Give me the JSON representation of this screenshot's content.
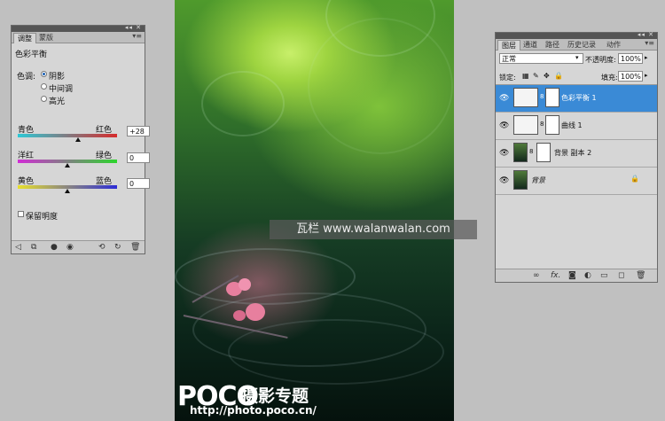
{
  "adjustments": {
    "tabs": [
      "调整",
      "蒙版"
    ],
    "title": "色彩平衡",
    "tone_label": "色调:",
    "tones": [
      "阴影",
      "中间调",
      "高光"
    ],
    "selected_tone": "阴影",
    "sliders": [
      {
        "left": "青色",
        "right": "红色",
        "value": "+28",
        "level": 0.61
      },
      {
        "left": "洋红",
        "right": "绿色",
        "value": "0",
        "level": 0.5
      },
      {
        "left": "黄色",
        "right": "蓝色",
        "value": "0",
        "level": 0.5
      }
    ],
    "preserve_luminosity": "保留明度",
    "footer_icons": [
      "back-icon",
      "clip-icon",
      "eye-icon",
      "view-previous-icon",
      "reset-icon",
      "delete-icon"
    ]
  },
  "layers": {
    "tabs": [
      "图层",
      "通道",
      "路径",
      "历史记录",
      "动作"
    ],
    "blend_mode": "正常",
    "opacity_label": "不透明度:",
    "opacity": "100%",
    "lock_label": "锁定:",
    "fill_label": "填充:",
    "fill": "100%",
    "items": [
      {
        "name": "色彩平衡 1",
        "selected": true
      },
      {
        "name": "曲线 1",
        "selected": false
      },
      {
        "name": "背景 副本 2",
        "selected": false
      },
      {
        "name": "背景",
        "selected": false
      }
    ],
    "footer_icons": [
      "link-icon",
      "fx-icon",
      "mask-icon",
      "adjustment-icon",
      "group-icon",
      "new-layer-icon",
      "delete-icon"
    ]
  },
  "photo": {
    "watermark": "瓦栏 www.walanwalan.com",
    "logo": "POCO",
    "logo_sub": "摄影专题",
    "url": "http://photo.poco.cn/"
  }
}
